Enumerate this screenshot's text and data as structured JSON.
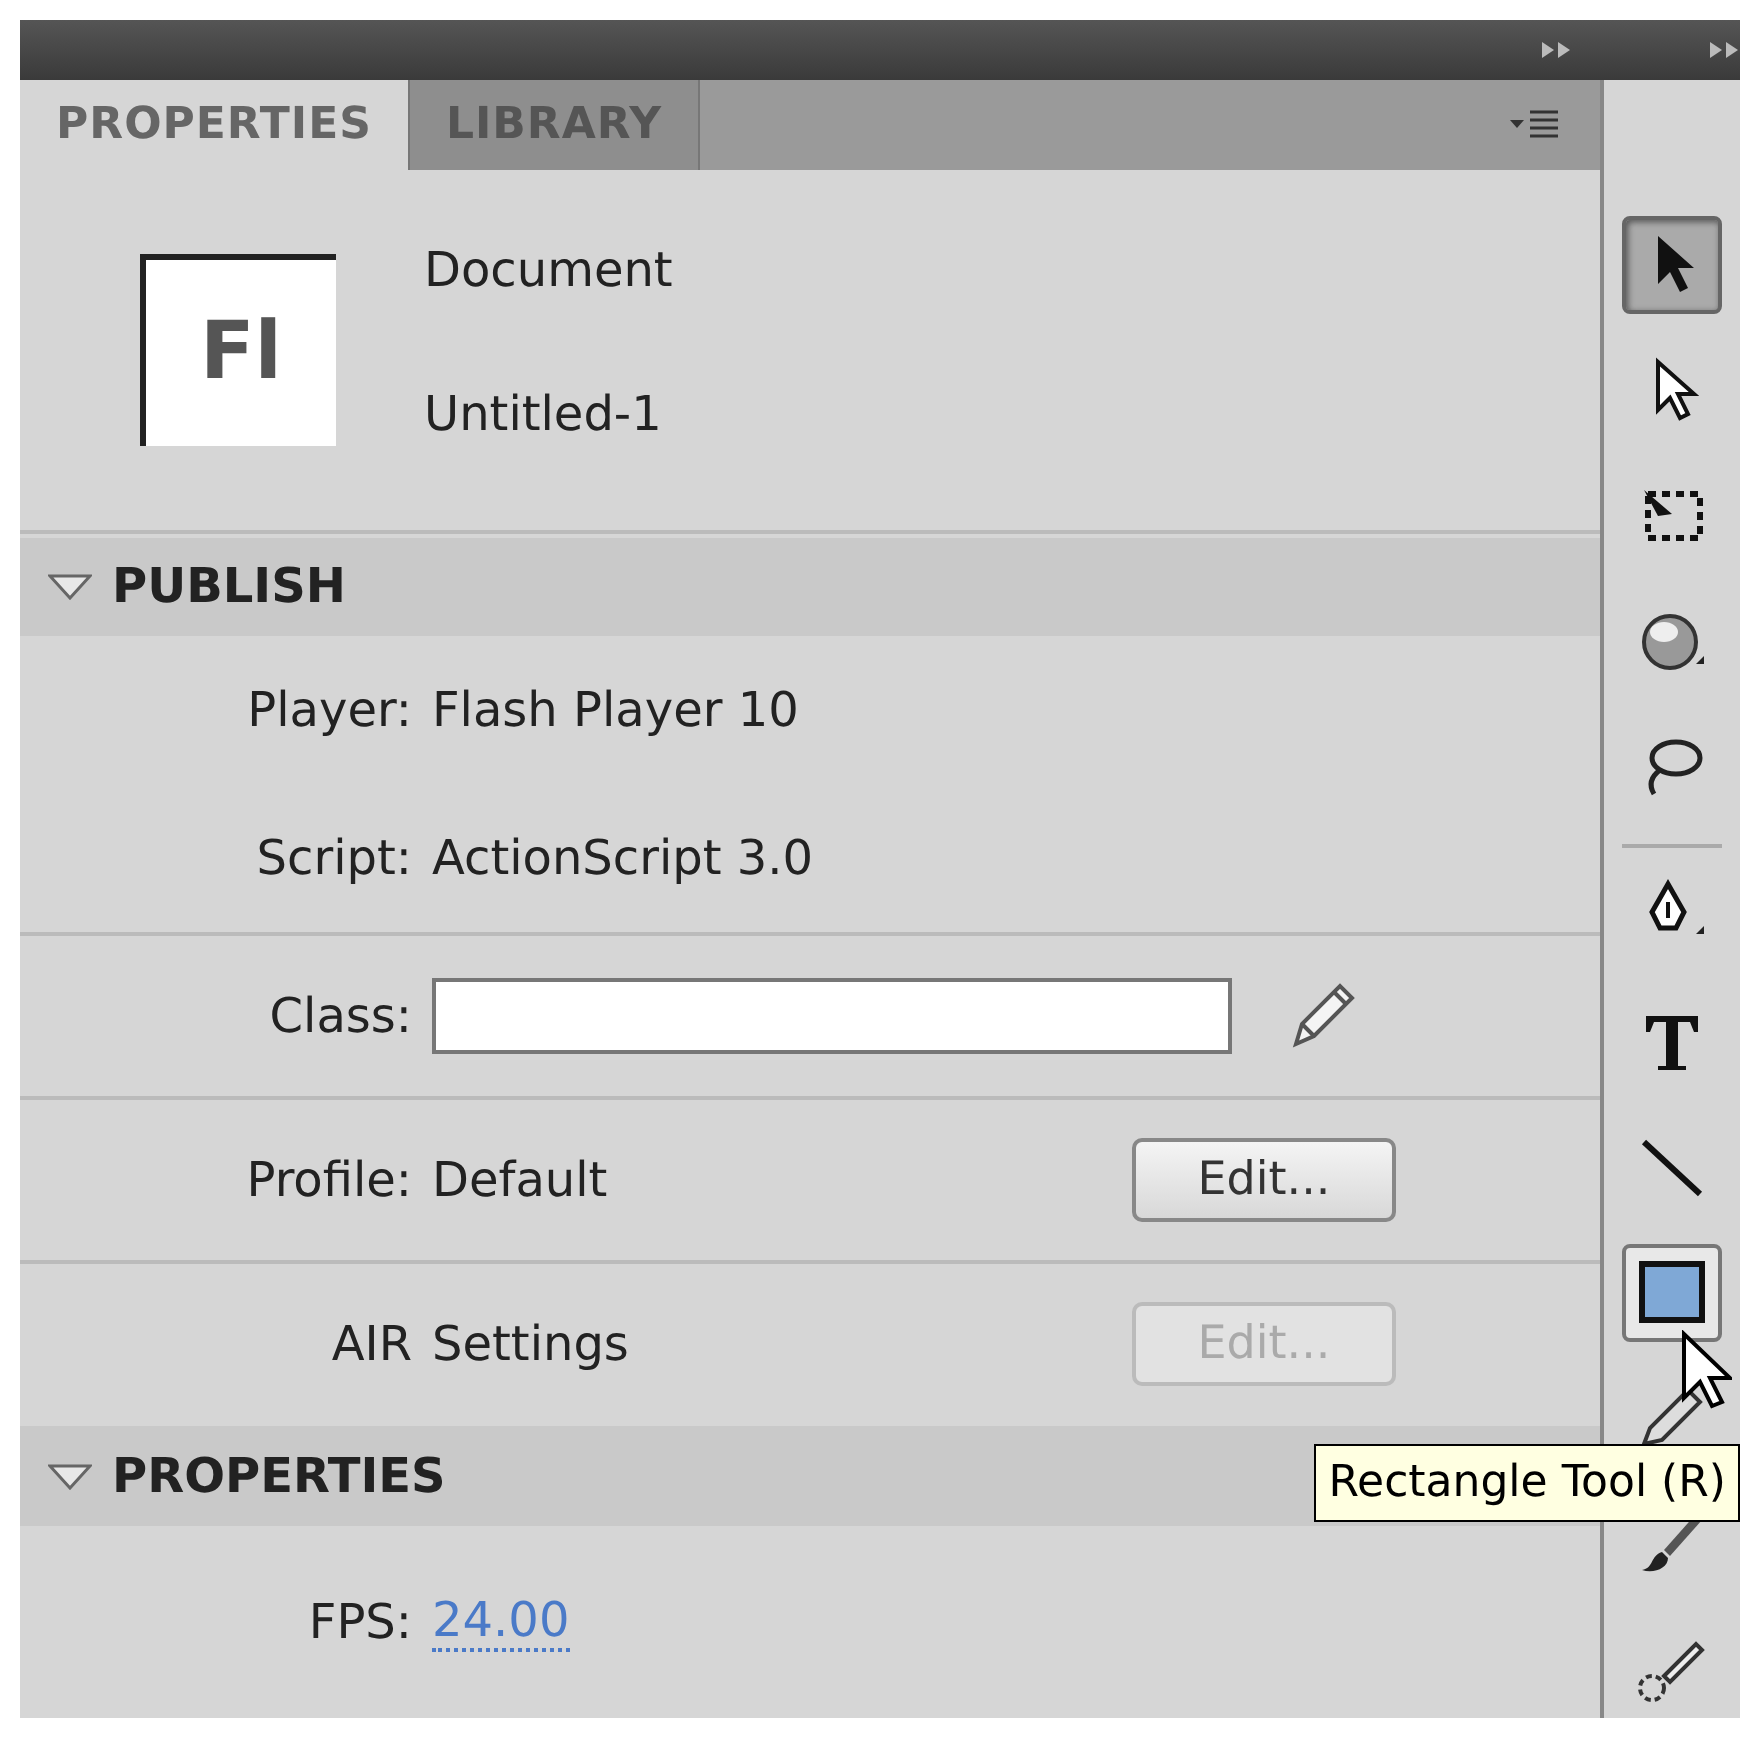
{
  "tabs": [
    {
      "label": "PROPERTIES",
      "selected": true
    },
    {
      "label": "LIBRARY",
      "selected": false
    }
  ],
  "document": {
    "logo": "Fl",
    "type": "Document",
    "name": "Untitled-1"
  },
  "sections": [
    {
      "title": "PUBLISH",
      "expanded": true,
      "rows": [
        {
          "kind": "info",
          "label": "Player:",
          "value": "Flash Player 10"
        },
        {
          "kind": "info",
          "label": "Script:",
          "value": "ActionScript 3.0"
        },
        {
          "kind": "field",
          "label": "Class:"
        },
        {
          "kind": "button",
          "label": "Profile:",
          "value": "Default",
          "button": "Edit...",
          "disabled": false
        },
        {
          "kind": "button",
          "label": "AIR",
          "value": "Settings",
          "button": "Edit...",
          "disabled": true
        }
      ]
    },
    {
      "title": "PROPERTIES",
      "expanded": true,
      "rows": [
        {
          "kind": "link",
          "label": "FPS:",
          "value": "24.00"
        }
      ]
    }
  ],
  "tools": [
    {
      "kind": "select",
      "selected": true,
      "hovered": false
    },
    {
      "kind": "subselect",
      "selected": false,
      "hovered": false
    },
    {
      "kind": "transform",
      "selected": false,
      "hovered": false
    },
    {
      "kind": "rotate",
      "selected": false,
      "hovered": false
    },
    {
      "kind": "lasso",
      "selected": false,
      "hovered": false
    },
    {
      "kind": "pen",
      "selected": false,
      "hovered": false
    },
    {
      "kind": "text",
      "selected": false,
      "hovered": false
    },
    {
      "kind": "line",
      "selected": false,
      "hovered": false
    },
    {
      "kind": "rectangle",
      "selected": false,
      "hovered": true
    },
    {
      "kind": "pencil",
      "selected": false,
      "hovered": false
    },
    {
      "kind": "brush",
      "selected": false,
      "hovered": false
    },
    {
      "kind": "deco",
      "selected": false,
      "hovered": false
    }
  ],
  "tooltip": "Rectangle Tool (R)"
}
